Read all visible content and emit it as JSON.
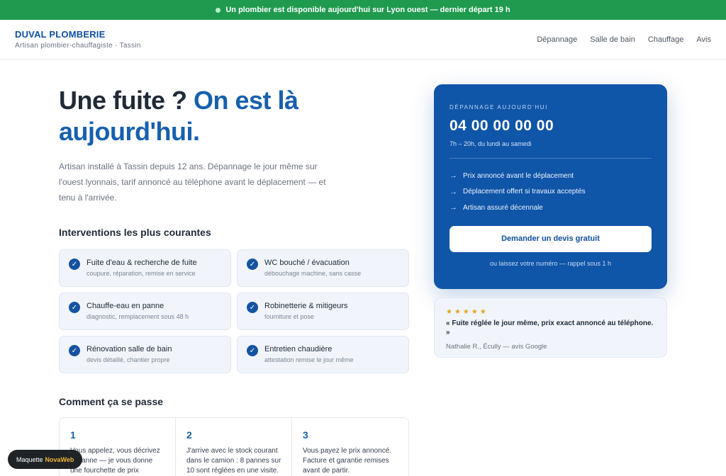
{
  "topbar": {
    "text": "Un plombier est disponible aujourd'hui sur Lyon ouest — dernier départ 19 h"
  },
  "brand": {
    "name": "DUVAL PLOMBERIE",
    "subtitle": "Artisan plombier-chauffagiste · Tassin"
  },
  "nav": {
    "links": [
      "Dépannage",
      "Salle de bain",
      "Chauffage",
      "Avis"
    ]
  },
  "hero": {
    "title_part1": "Une fuite ?",
    "title_accent": "On est là aujourd'hui.",
    "lead": "Artisan installé à Tassin depuis 12 ans. Dépannage le jour même sur l'ouest lyonnais, tarif annoncé au téléphone avant le déplacement — et tenu à l'arrivée."
  },
  "interventions": {
    "heading": "Interventions les plus courantes",
    "items": [
      {
        "title": "Fuite d'eau & recherche de fuite",
        "sub": "coupure, réparation, remise en service"
      },
      {
        "title": "WC bouché / évacuation",
        "sub": "débouchage machine, sans casse"
      },
      {
        "title": "Chauffe-eau en panne",
        "sub": "diagnostic, remplacement sous 48 h"
      },
      {
        "title": "Robinetterie & mitigeurs",
        "sub": "fourniture et pose"
      },
      {
        "title": "Rénovation salle de bain",
        "sub": "devis détaillé, chantier propre"
      },
      {
        "title": "Entretien chaudière",
        "sub": "attestation remise le jour même"
      }
    ]
  },
  "process": {
    "heading": "Comment ça se passe",
    "steps": [
      {
        "num": "1",
        "text": "Vous appelez, vous décrivez la panne — je vous donne une fourchette de prix immédiatement."
      },
      {
        "num": "2",
        "text": "J'arrive avec le stock courant dans le camion : 8 pannes sur 10 sont réglées en une visite."
      },
      {
        "num": "3",
        "text": "Vous payez le prix annoncé. Facture et garantie remises avant de partir."
      }
    ]
  },
  "cta": {
    "kicker": "DÉPANNAGE AUJOURD'HUI",
    "phone": "04 00 00 00 00",
    "hours": "7h – 20h, du lundi au samedi",
    "list": [
      "Prix annoncé avant le déplacement",
      "Déplacement offert si travaux acceptés",
      "Artisan assuré décennale"
    ],
    "button": "Demander un devis gratuit",
    "note": "ou laissez votre numéro — rappel sous 1 h"
  },
  "review": {
    "stars": "★★★★★",
    "quote": "« Fuite réglée le jour même, prix exact annoncé au téléphone. »",
    "author": "Nathalie R., Écully — avis Google"
  },
  "badge": {
    "prefix": "Maquette",
    "brand": "NovaWeb"
  },
  "colors": {
    "accent": "#1760ad",
    "cta_bg": "#0f55a8",
    "topbar": "#1f9a4f",
    "stars": "#e5a41a"
  }
}
